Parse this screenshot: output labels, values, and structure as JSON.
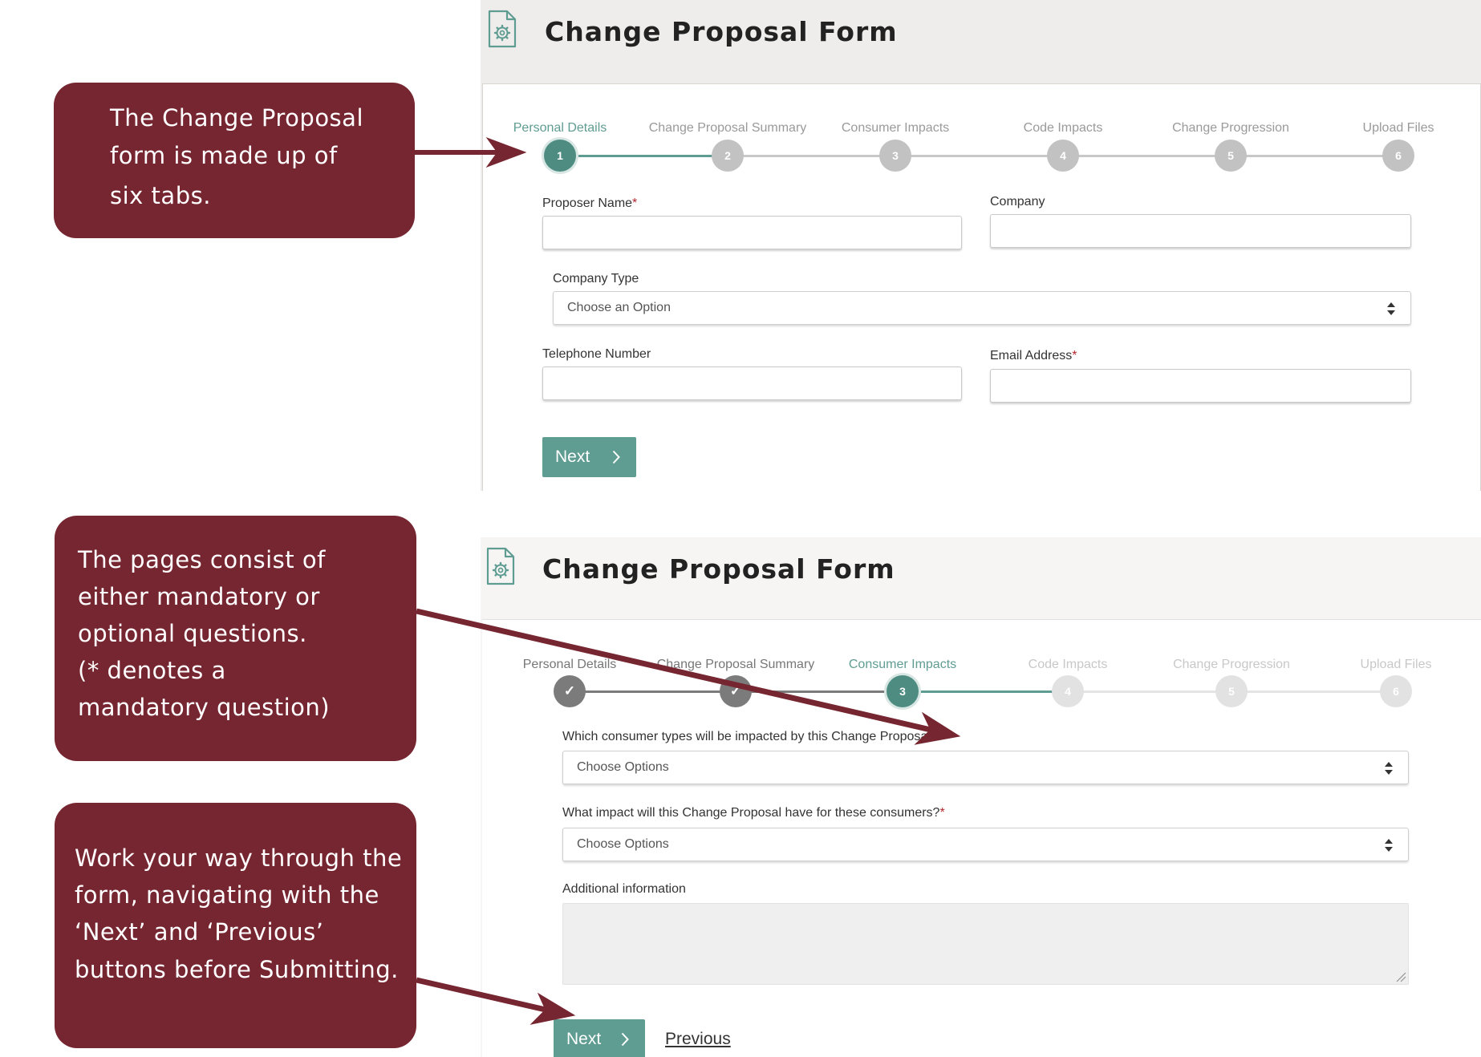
{
  "form_title": "Change Proposal Form",
  "callouts": {
    "c1": [
      "The Change Proposal",
      "form is made up of",
      "six tabs."
    ],
    "c2": [
      "The pages consist of",
      "either mandatory or",
      "optional questions.",
      "(* denotes a",
      "mandatory question)"
    ],
    "c3": [
      "Work your way through the",
      "form, navigating with the",
      "‘Next’ and  ‘Previous’",
      "buttons before Submitting."
    ]
  },
  "steps": [
    "Personal Details",
    "Change Proposal Summary",
    "Consumer Impacts",
    "Code Impacts",
    "Change Progression",
    "Upload Files"
  ],
  "step_numbers": [
    "1",
    "2",
    "3",
    "4",
    "5",
    "6"
  ],
  "step_done_mark": "✓",
  "top_form": {
    "proposer_name_label": "Proposer Name",
    "company_label": "Company",
    "company_type_label": "Company Type",
    "company_type_placeholder": "Choose an Option",
    "telephone_label": "Telephone Number",
    "email_label": "Email Address",
    "required_mark": "*",
    "next_label": "Next"
  },
  "bottom_form": {
    "q1_label": "Which consumer types will be impacted by this Change Proposal?",
    "q1_placeholder": "Choose Options",
    "q2_label": "What impact will this Change Proposal have for these consumers?",
    "q2_placeholder": "Choose Options",
    "additional_label": "Additional information",
    "required_mark": "*",
    "next_label": "Next",
    "previous_label": "Previous"
  },
  "colors": {
    "callout_bg": "#762630",
    "accent_teal": "#5f9c92",
    "step_inactive": "#c2c2c2",
    "step_done": "#7b7b7b",
    "required": "#b3262e"
  }
}
